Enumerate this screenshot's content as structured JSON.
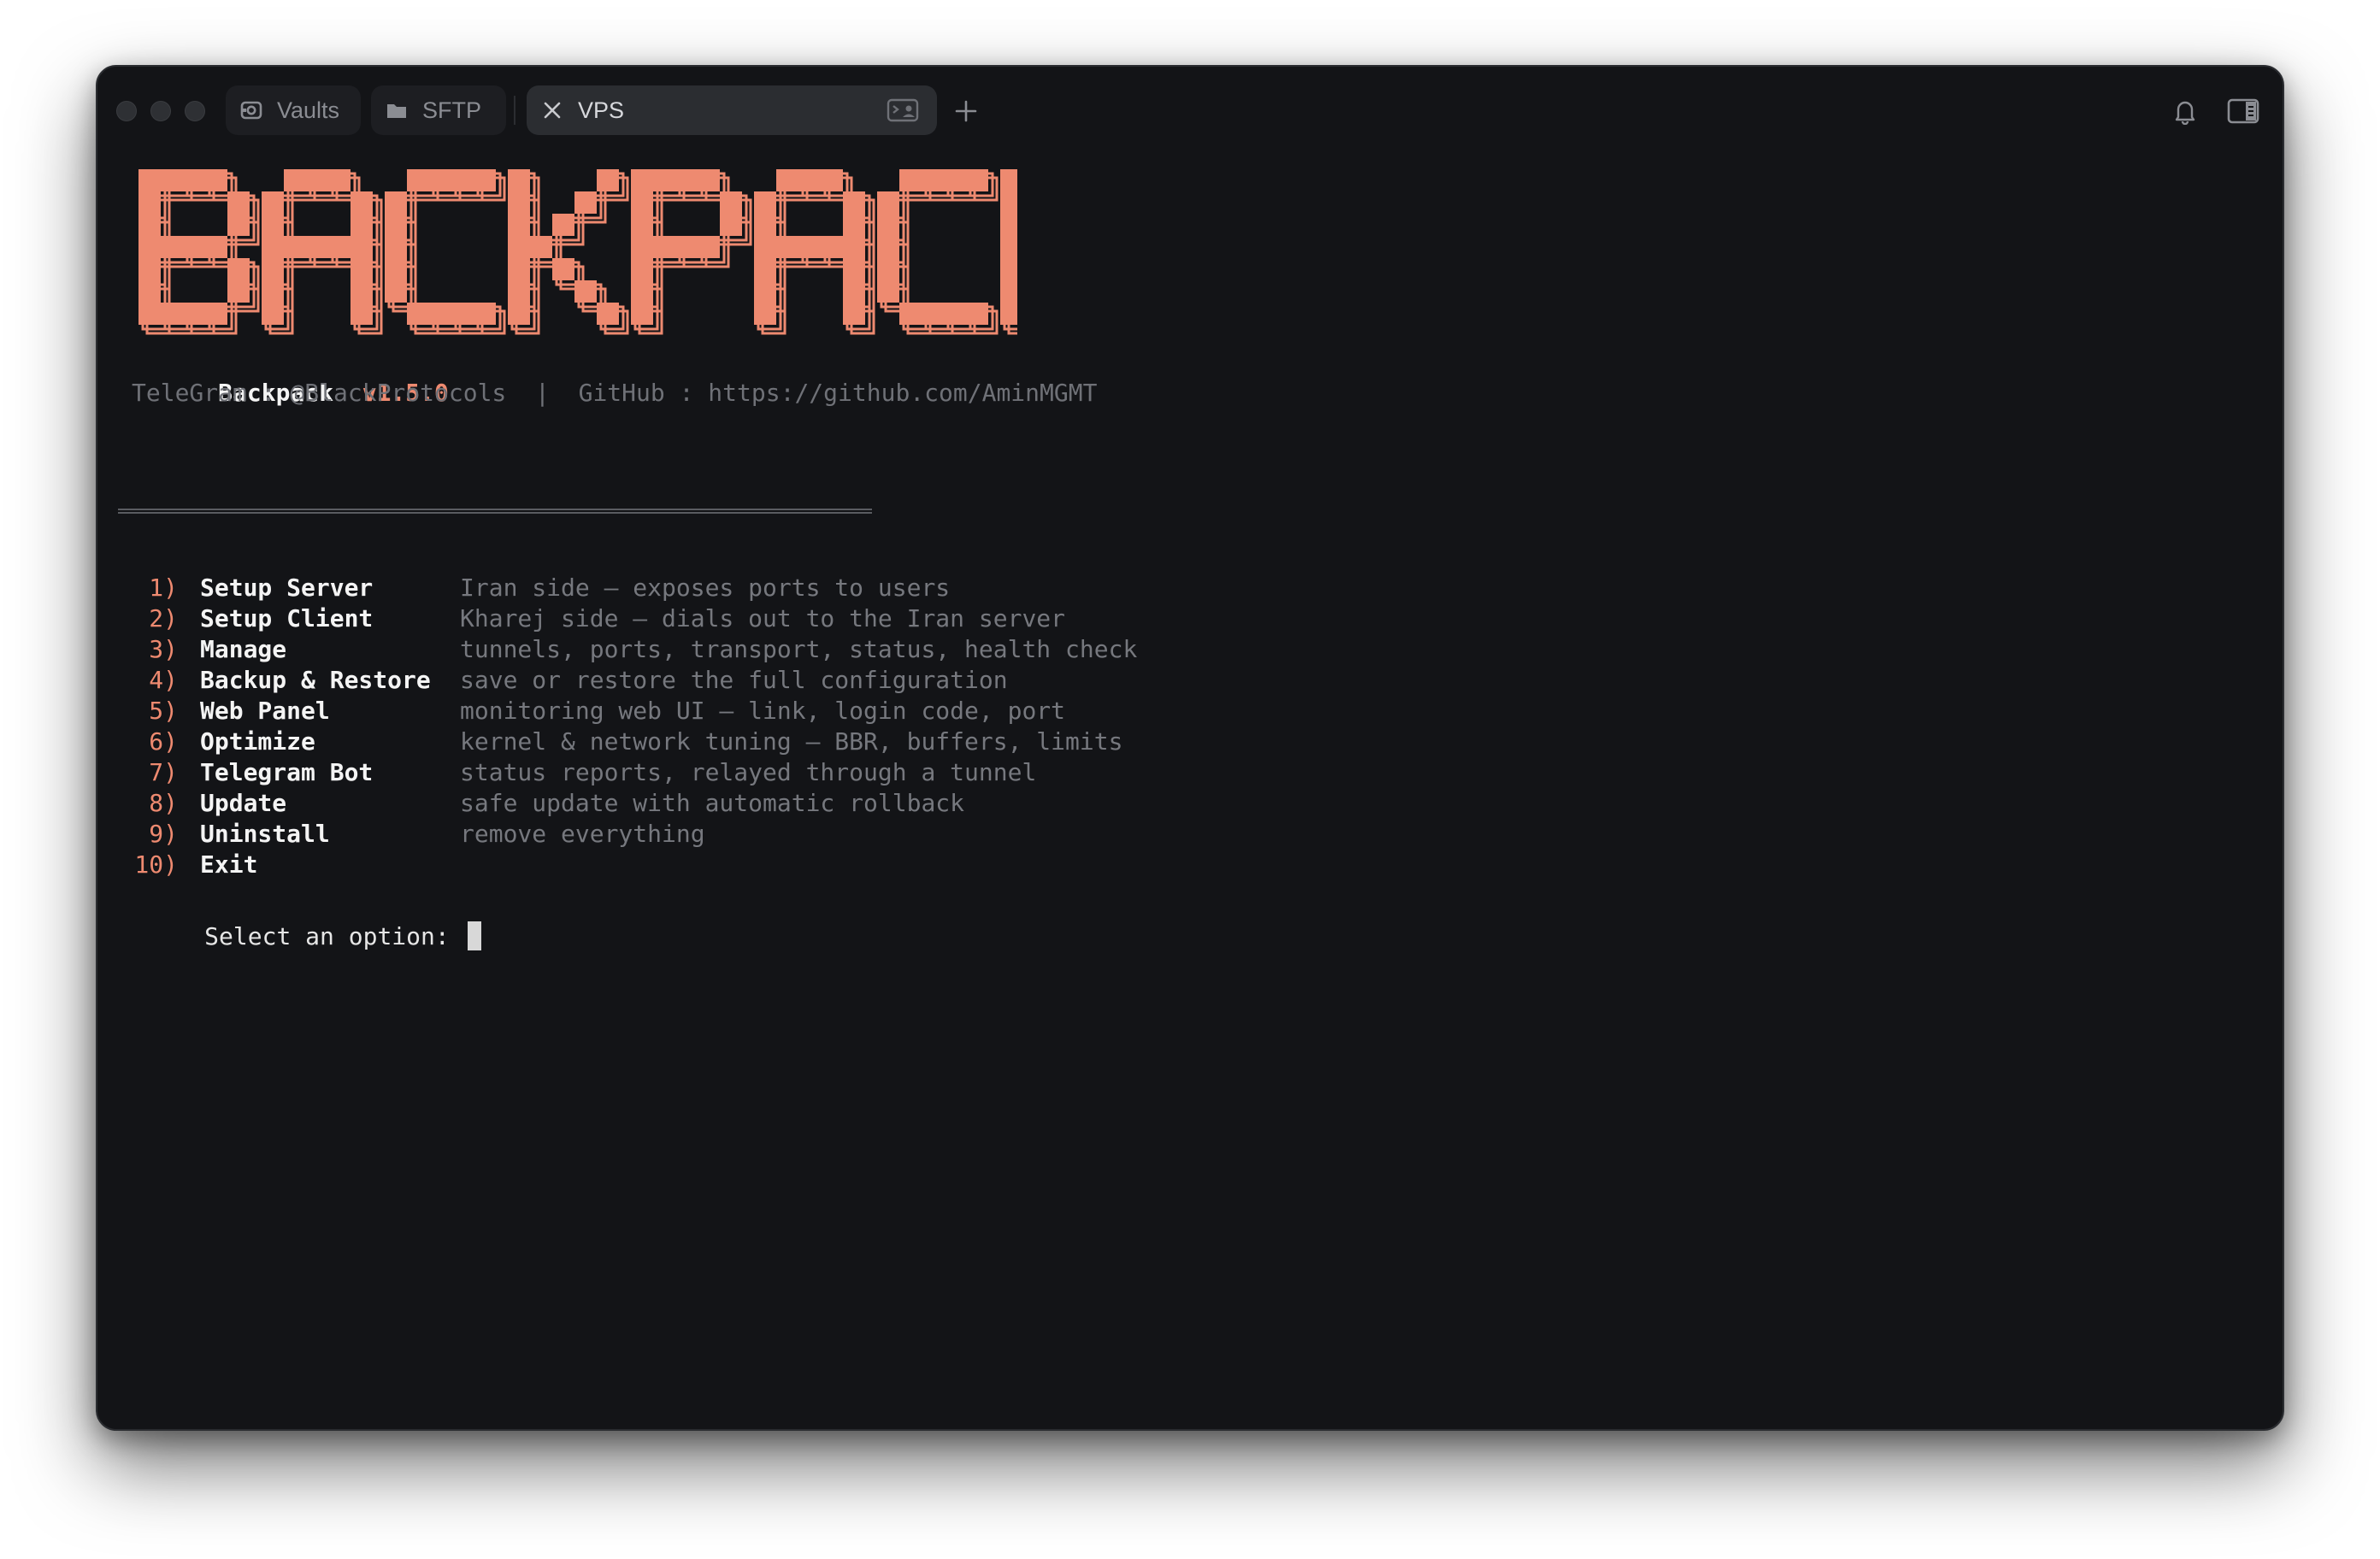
{
  "tabs": [
    {
      "label": "Vaults",
      "icon": "vault-icon",
      "active": false
    },
    {
      "label": "SFTP",
      "icon": "folder-icon",
      "active": false
    },
    {
      "label": "VPS",
      "icon": "close-icon",
      "active": true
    }
  ],
  "toolbar": {
    "new_tab_icon": "plus-icon",
    "notifications_icon": "bell-icon",
    "sidebar_icon": "sidebar-toggle-icon",
    "tab_terminal_icon": "terminal-profile-icon"
  },
  "banner": {
    "art_text": "BACKPACK",
    "app_name": "Backpack",
    "version": "v1.5.0",
    "contact_line": "TeleGram : @BlackProtocols  |  GitHub : https://github.com/AminMGMT"
  },
  "menu": {
    "items": [
      {
        "number": "1)",
        "label": "Setup Server",
        "description": "Iran side — exposes ports to users"
      },
      {
        "number": "2)",
        "label": "Setup Client",
        "description": "Kharej side — dials out to the Iran server"
      },
      {
        "number": "3)",
        "label": "Manage",
        "description": "tunnels, ports, transport, status, health check"
      },
      {
        "number": "4)",
        "label": "Backup & Restore",
        "description": "save or restore the full configuration"
      },
      {
        "number": "5)",
        "label": "Web Panel",
        "description": "monitoring web UI — link, login code, port"
      },
      {
        "number": "6)",
        "label": "Optimize",
        "description": "kernel & network tuning — BBR, buffers, limits"
      },
      {
        "number": "7)",
        "label": "Telegram Bot",
        "description": "status reports, relayed through a tunnel"
      },
      {
        "number": "8)",
        "label": "Update",
        "description": "safe update with automatic rollback"
      },
      {
        "number": "9)",
        "label": "Uninstall",
        "description": "remove everything"
      },
      {
        "number": "10)",
        "label": "Exit",
        "description": ""
      }
    ]
  },
  "prompt": {
    "text": "Select an option: "
  },
  "colors": {
    "accent": "#ee8a70",
    "background": "#131417",
    "muted_text": "#76787e",
    "bright_text": "#f4f4f4"
  }
}
